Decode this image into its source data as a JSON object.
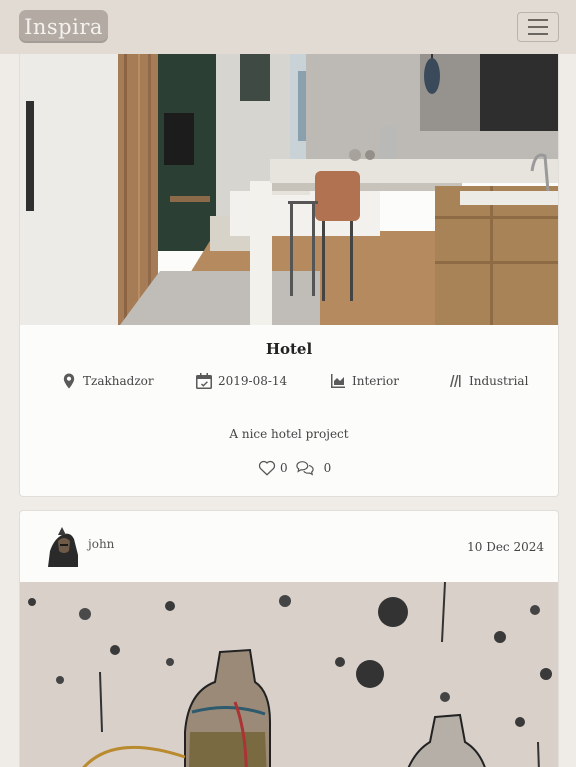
{
  "navbar": {
    "logo_text": "Inspira",
    "toggler_icon": "hamburger-menu-icon"
  },
  "project_card": {
    "title": "Hotel",
    "location": "Tzakhadzor",
    "date": "2019-08-14",
    "category": "Interior",
    "style": "Industrial",
    "description": "A nice hotel project",
    "likes": "0",
    "comments": "0",
    "icons": {
      "location": "map-pin-icon",
      "date": "calendar-check-icon",
      "category": "area-chart-icon",
      "style": "slanted-lines-icon",
      "likes": "heart-icon",
      "comments": "comments-icon"
    }
  },
  "post_card": {
    "author": "john",
    "date": "10 Dec 2024"
  },
  "colors": {
    "navbar_bg": "#e1dbd3",
    "page_bg": "#efece8",
    "logo_bg": "#b2aaa3",
    "card_bg": "#fcfcfb"
  }
}
